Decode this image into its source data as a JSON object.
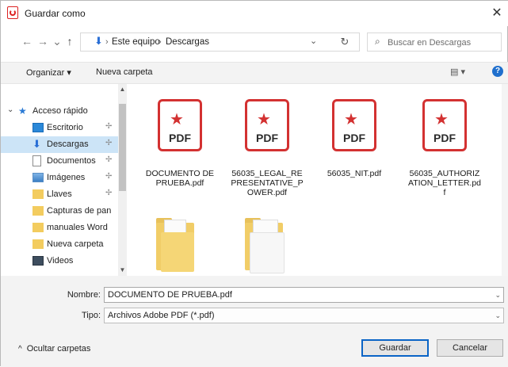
{
  "window": {
    "title": "Guardar como",
    "close_glyph": "✕",
    "icon": "acrobat-pdf-icon"
  },
  "nav": {
    "back": "←",
    "forward": "→",
    "recent": "⌄",
    "up": "↑"
  },
  "address": {
    "crumbs": [
      "Este equipo",
      "Descargas"
    ],
    "separator": "›",
    "dropdown": "⌄",
    "refresh": "↻"
  },
  "search": {
    "placeholder": "Buscar en Descargas",
    "icon": "⌕"
  },
  "toolbar": {
    "organize": "Organizar ▾",
    "new_folder": "Nueva carpeta",
    "view": "▤ ▾",
    "help": "?"
  },
  "sidebar": {
    "items": [
      {
        "label": "Acceso rápido",
        "icon": "star-icon",
        "pin": ""
      },
      {
        "label": "Escritorio",
        "icon": "desktop-icon",
        "pin": "✢"
      },
      {
        "label": "Descargas",
        "icon": "download-icon",
        "pin": "✢"
      },
      {
        "label": "Documentos",
        "icon": "documents-icon",
        "pin": "✢"
      },
      {
        "label": "Imágenes",
        "icon": "pictures-icon",
        "pin": "✢"
      },
      {
        "label": "Llaves",
        "icon": "folder-icon",
        "pin": "✢"
      },
      {
        "label": "Capturas de pan",
        "icon": "folder-icon",
        "pin": ""
      },
      {
        "label": "manuales Word",
        "icon": "folder-icon",
        "pin": ""
      },
      {
        "label": "Nueva carpeta",
        "icon": "folder-icon",
        "pin": ""
      },
      {
        "label": "Videos",
        "icon": "videos-icon",
        "pin": ""
      }
    ],
    "expand": "⌄",
    "scroll_up": "▲",
    "scroll_down": "▼"
  },
  "files": [
    {
      "name": "DOCUMENTO DE PRUEBA.pdf",
      "type": "pdf",
      "badge": "PDF"
    },
    {
      "name": "56035_LEGAL_REPRESENTATIVE_POWER.pdf",
      "type": "pdf",
      "badge": "PDF"
    },
    {
      "name": "56035_NIT.pdf",
      "type": "pdf",
      "badge": "PDF"
    },
    {
      "name": "56035_AUTHORIZATION_LETTER.pdf",
      "type": "pdf",
      "badge": "PDF"
    },
    {
      "name": "",
      "type": "folder"
    },
    {
      "name": "",
      "type": "folder"
    }
  ],
  "form": {
    "name_label": "Nombre:",
    "name_value": "DOCUMENTO DE PRUEBA.pdf",
    "type_label": "Tipo:",
    "type_value": "Archivos Adobe PDF (*.pdf)",
    "caret": "⌄"
  },
  "footer": {
    "hide_folders": "Ocultar carpetas",
    "hide_folders_icon": "^",
    "save": "Guardar",
    "cancel": "Cancelar"
  }
}
